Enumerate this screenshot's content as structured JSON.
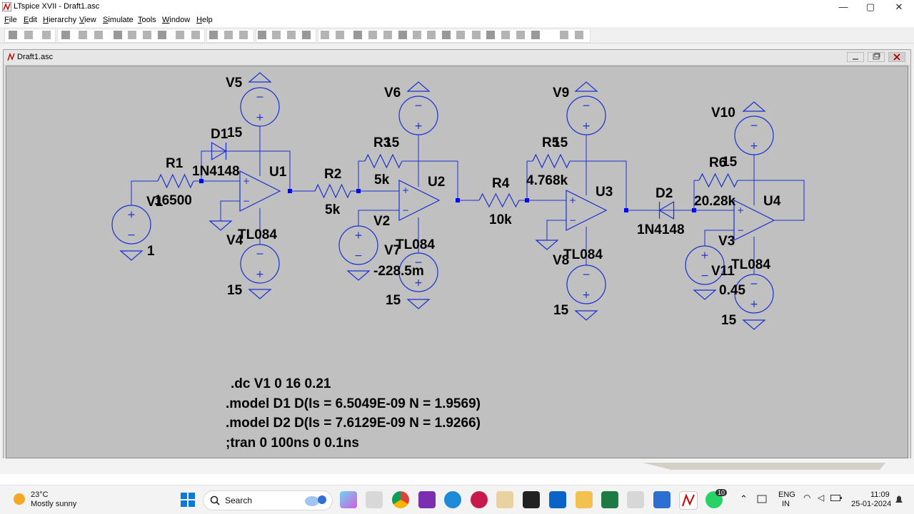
{
  "window": {
    "title": "LTspice XVII - Draft1.asc",
    "minimize": "—",
    "maximize": "▢",
    "close": "✕"
  },
  "menu": [
    "File",
    "Edit",
    "Hierarchy",
    "View",
    "Simulate",
    "Tools",
    "Window",
    "Help"
  ],
  "toolbar": {
    "icons": [
      "new-schematic-icon",
      "open-icon",
      "save-icon",
      "control-panel-icon",
      "run-icon",
      "halt-icon",
      "zoom-in-icon",
      "pan-icon",
      "zoom-out-icon",
      "zoom-fit-icon",
      "autoscale-icon",
      "tile-horizontal-icon",
      "tile-vertical-icon",
      "cascade-icon",
      "cut-icon",
      "copy-icon",
      "paste-icon",
      "find-icon",
      "print-icon",
      "print-preview-icon",
      "wire-icon",
      "ground-icon",
      "label-net-icon",
      "resistor-icon",
      "capacitor-icon",
      "inductor-icon",
      "diode-icon",
      "component-icon",
      "move-icon",
      "drag-icon",
      "undo-icon",
      "redo-icon",
      "rotate-icon",
      "mirror-icon",
      "text-icon",
      "spice-directive-icon"
    ]
  },
  "document": {
    "title": "Draft1.asc"
  },
  "schematic": {
    "labels": {
      "v5": "V5",
      "v5_val": "15",
      "d1": "D1",
      "d1_model": "1N4148",
      "r1": "R1",
      "r1_val": "16500",
      "u1": "U1",
      "u1_model": "TL084",
      "v1": "V1",
      "v1_val": "1",
      "v4": "V4",
      "v4_val": "15",
      "r2": "R2",
      "r2_val": "5k",
      "v6": "V6",
      "v6_val": "15",
      "r3": "R3",
      "r3_val": "5k",
      "u2": "U2",
      "u2_model": "TL084",
      "v2": "V2",
      "v7": "V7",
      "v7_val": "-228.5m",
      "v7_bottom": "15",
      "r4": "R4",
      "r4_val": "10k",
      "v9": "V9",
      "v9_val": "15",
      "r5": "R5",
      "r5_val": "4.768k",
      "u3": "U3",
      "u3_model": "TL084",
      "v8": "V8",
      "v8_val": "15",
      "d2": "D2",
      "d2_model": "1N4148",
      "v10": "V10",
      "v10_val": "15",
      "r6": "R6",
      "r6_val": "20.28k",
      "u4": "U4",
      "u4_model": "TL084",
      "v3": "V3",
      "v11": "V11",
      "v11_val": "0.45",
      "v11_bottom": "15"
    },
    "directives": [
      ".dc V1 0 16 0.21",
      ".model D1 D(Is = 6.5049E-09 N = 1.9569)",
      ".model D2 D(Is = 7.6129E-09 N = 1.9266)",
      ";tran 0 100ns 0 0.1ns"
    ],
    "colors": {
      "wire": "#1a2fd1",
      "component": "#1a2fd1",
      "junction": "#0000ff",
      "background": "#c0c0c0"
    }
  },
  "taskbar": {
    "weather_temp": "23°C",
    "weather_desc": "Mostly sunny",
    "search_placeholder": "Search",
    "lang1": "ENG",
    "lang2": "IN",
    "time": "11:09",
    "date": "25-01-2024",
    "whatsapp_badge": "10"
  }
}
